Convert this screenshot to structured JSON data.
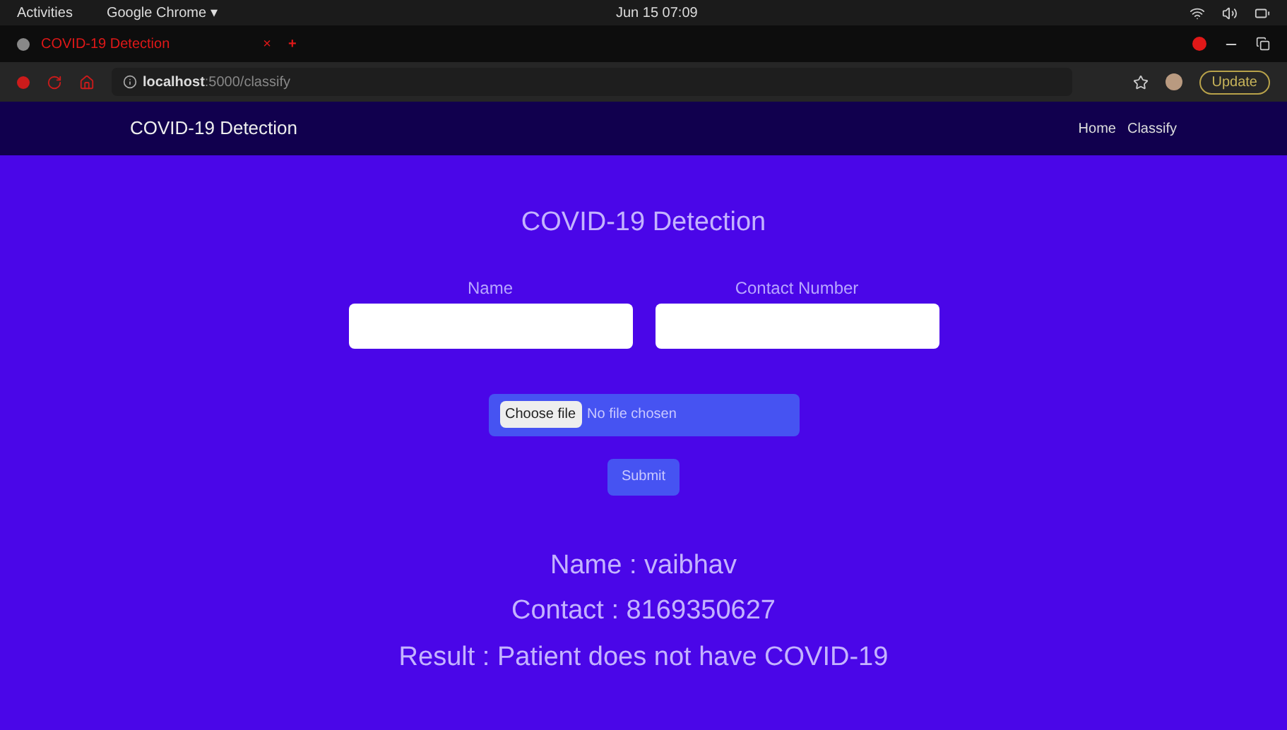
{
  "system_bar": {
    "activities": "Activities",
    "app_menu": "Google Chrome ▾",
    "clock": "Jun 15 07:09"
  },
  "browser": {
    "tab": {
      "title": "COVID-19 Detection",
      "close": "×",
      "new_tab": "+"
    },
    "address": {
      "host": "localhost",
      "path": ":5000/classify"
    },
    "update_button": "Update"
  },
  "navbar": {
    "brand": "COVID-19 Detection",
    "links": [
      {
        "label": "Home"
      },
      {
        "label": "Classify"
      }
    ]
  },
  "form": {
    "title": "COVID-19 Detection",
    "fields": [
      {
        "label": "Name"
      },
      {
        "label": "Contact Number"
      }
    ],
    "file": {
      "button": "Choose file",
      "status": "No file chosen"
    },
    "submit": "Submit"
  },
  "result": [
    "Name : vaibhav",
    "Contact : 8169350627",
    "Result : Patient does not have COVID-19"
  ]
}
